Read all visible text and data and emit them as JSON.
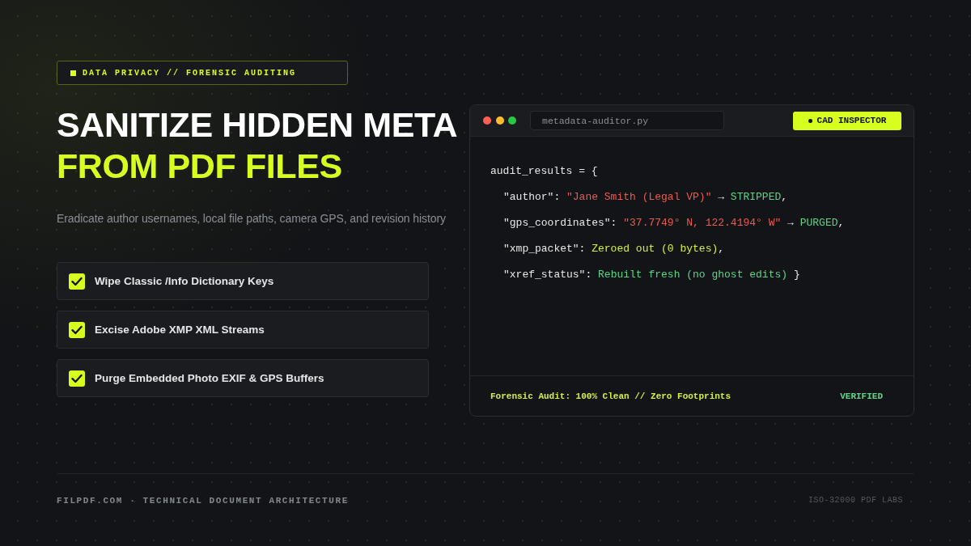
{
  "tag": {
    "label": "DATA PRIVACY // FORENSIC AUDITING"
  },
  "headline": {
    "line_1": "SANITIZE HIDDEN META",
    "line_2": "FROM PDF FILES"
  },
  "subtitle": "Eradicate author usernames, local file paths, camera GPS, and revision history",
  "checklist": [
    {
      "label": "Wipe Classic /Info Dictionary Keys",
      "checked": true
    },
    {
      "label": "Excise Adobe XMP XML Streams",
      "checked": true
    },
    {
      "label": "Purge Embedded Photo EXIF & GPS Buffers",
      "checked": true
    }
  ],
  "editor": {
    "filename": "metadata-auditor.py",
    "badge": {
      "label": "CAD INSPECTOR"
    },
    "code": {
      "opening": [
        {
          "kind": "plain",
          "text": "audit_results = {"
        }
      ],
      "entries": [
        [
          {
            "kind": "plain",
            "text": "\"author\": "
          },
          {
            "kind": "string",
            "text": "\"Jane Smith (Legal VP)\""
          },
          {
            "kind": "plain",
            "text": " → "
          },
          {
            "kind": "ok",
            "text": "STRIPPED"
          },
          {
            "kind": "plain",
            "text": ","
          }
        ],
        [
          {
            "kind": "plain",
            "text": "\"gps_coordinates\": "
          },
          {
            "kind": "string",
            "text": "\"37.7749° N, 122.4194° W\""
          },
          {
            "kind": "plain",
            "text": " → "
          },
          {
            "kind": "ok",
            "text": "PURGED"
          },
          {
            "kind": "plain",
            "text": ","
          }
        ],
        [
          {
            "kind": "plain",
            "text": "\"xmp_packet\": "
          },
          {
            "kind": "value",
            "text": "Zeroed out (0 bytes)"
          },
          {
            "kind": "plain",
            "text": ","
          }
        ],
        [
          {
            "kind": "plain",
            "text": "\"xref_status\": "
          },
          {
            "kind": "ok",
            "text": "Rebuilt fresh (no ghost edits)"
          },
          {
            "kind": "plain",
            "text": " }"
          }
        ]
      ]
    },
    "status_bar": {
      "summary": "Forensic Audit: 100% Clean // Zero Footprints",
      "status": "VERIFIED"
    }
  },
  "footer": {
    "left": "FILPDF.COM · TECHNICAL DOCUMENT ARCHITECTURE",
    "right": "ISO-32000 PDF LABS"
  }
}
